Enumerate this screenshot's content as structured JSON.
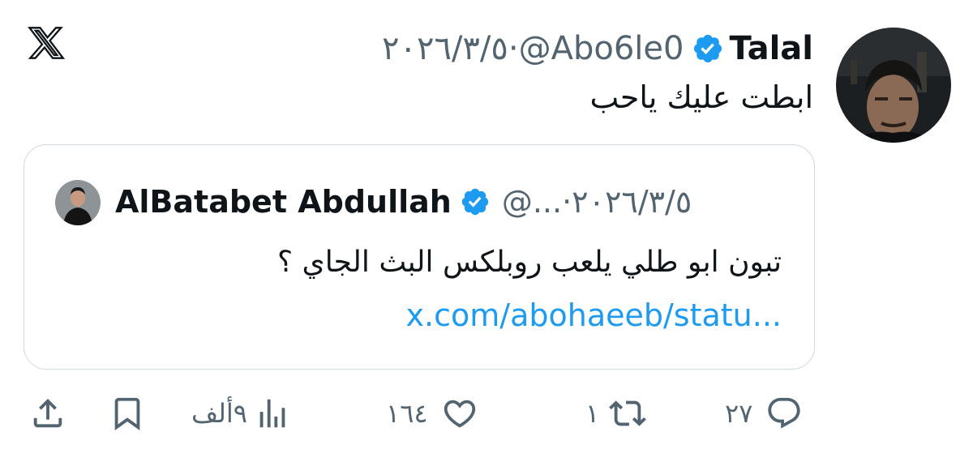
{
  "post": {
    "author_name": "Talal",
    "author_handle": "@Abo6le0",
    "separator": "·",
    "date": "٢٠٢٦/٣/٥",
    "text": "ابطت عليك ياحب"
  },
  "quote": {
    "author_name": "AlBatabet Abdullah",
    "author_handle": "@...",
    "separator": "·",
    "date": "٢٠٢٦/٣/٥",
    "text": "تبون ابو طلي يلعب روبلكس البث الجاي ؟",
    "link": "x.com/abohaeeb/statu..."
  },
  "actions": {
    "replies": "٢٧",
    "reposts": "١",
    "likes": "١٦٤",
    "views": "٩ألف"
  },
  "icons": {
    "logo": "x-logo-icon",
    "verified": "verified-badge-icon",
    "reply": "reply-icon",
    "repost": "repost-icon",
    "like": "heart-icon",
    "views": "views-icon",
    "bookmark": "bookmark-icon",
    "share": "share-icon"
  },
  "colors": {
    "verified": "#1d9bf0",
    "link": "#1d9bf0",
    "muted_text": "#536471",
    "text": "#0f1419",
    "border": "#cfd9de"
  }
}
